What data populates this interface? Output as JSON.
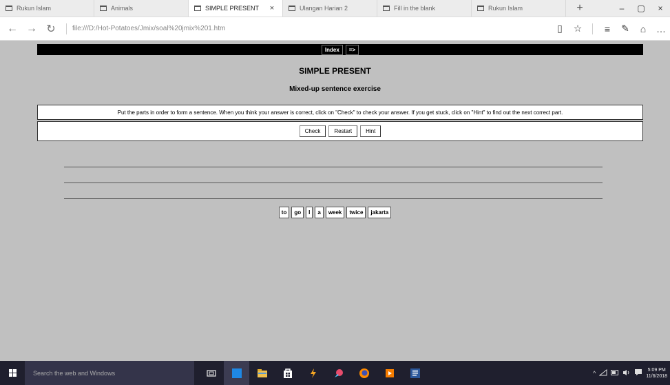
{
  "browser": {
    "tabs": [
      {
        "label": "Rukun Islam"
      },
      {
        "label": "Animals"
      },
      {
        "label": "SIMPLE PRESENT",
        "close": "×"
      },
      {
        "label": "Ulangan Harian 2"
      },
      {
        "label": "Fill in the blank"
      },
      {
        "label": "Rukun Islam"
      }
    ],
    "new_tab": "+",
    "window_controls": {
      "minimize": "–",
      "maximize": "▢",
      "close": "×"
    },
    "nav": {
      "back": "←",
      "forward": "→",
      "refresh": "↻"
    },
    "url": "file:///D:/Hot-Potatoes/Jmix/soal%20jmix%201.htm",
    "toolbar_icons": {
      "reading_view": "▯",
      "favorites": "☆",
      "hub": "≡",
      "web_note": "✎",
      "share": "⌂",
      "more": "…"
    }
  },
  "page": {
    "nav_links": [
      "Index",
      "=>"
    ],
    "title": "SIMPLE PRESENT",
    "subtitle": "Mixed-up sentence exercise",
    "instructions": "Put the parts in order to form a sentence. When you think your answer is correct, click on \"Check\" to check your answer. If you get stuck, click on \"Hint\" to find out the next correct part.",
    "buttons": {
      "check": "Check",
      "restart": "Restart",
      "hint": "Hint"
    },
    "words": [
      "to",
      "go",
      "I",
      "a",
      "week",
      "twice",
      "jakarta"
    ]
  },
  "taskbar": {
    "search_placeholder": "Search the web and Windows",
    "icons": [
      "task-view",
      "edge",
      "file-explorer",
      "store",
      "winamp",
      "app",
      "firefox",
      "media",
      "word"
    ],
    "tray": {
      "chevron": "^",
      "clock_time": "5:09 PM",
      "clock_date": "11/6/2018"
    }
  }
}
